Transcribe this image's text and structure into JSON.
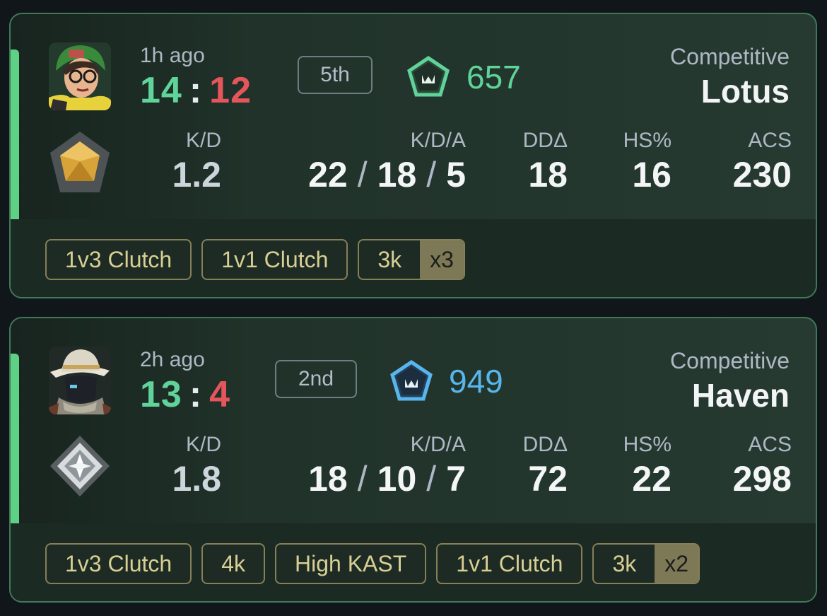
{
  "matches": [
    {
      "time_ago": "1h ago",
      "score_won": "14",
      "score_sep": ":",
      "score_lost": "12",
      "placement": "5th",
      "rr": "657",
      "rr_color": "#5fd39a",
      "rr_icon": "green-rank-rating-icon",
      "mode": "Competitive",
      "map": "Lotus",
      "agent_icon": "killjoy-agent-portrait",
      "rank_icon": "gold-rank-icon",
      "stats": {
        "kd_label": "K/D",
        "kd": "1.2",
        "kda_label": "K/D/A",
        "kills": "22",
        "deaths": "18",
        "assists": "5",
        "dd_label": "DDΔ",
        "dd": "18",
        "hs_label": "HS%",
        "hs": "16",
        "acs_label": "ACS",
        "acs": "230"
      },
      "tags": [
        {
          "label": "1v3 Clutch"
        },
        {
          "label": "1v1 Clutch"
        },
        {
          "label": "3k",
          "count": "x3"
        }
      ]
    },
    {
      "time_ago": "2h ago",
      "score_won": "13",
      "score_sep": ":",
      "score_lost": "4",
      "placement": "2nd",
      "rr": "949",
      "rr_color": "#58b6ec",
      "rr_icon": "blue-rank-rating-icon",
      "mode": "Competitive",
      "map": "Haven",
      "agent_icon": "cypher-agent-portrait",
      "rank_icon": "silver-rank-icon",
      "stats": {
        "kd_label": "K/D",
        "kd": "1.8",
        "kda_label": "K/D/A",
        "kills": "18",
        "deaths": "10",
        "assists": "7",
        "dd_label": "DDΔ",
        "dd": "72",
        "hs_label": "HS%",
        "hs": "22",
        "acs_label": "ACS",
        "acs": "298"
      },
      "tags": [
        {
          "label": "1v3 Clutch"
        },
        {
          "label": "4k"
        },
        {
          "label": "High KAST"
        },
        {
          "label": "1v1 Clutch"
        },
        {
          "label": "3k",
          "count": "x2"
        }
      ]
    }
  ]
}
